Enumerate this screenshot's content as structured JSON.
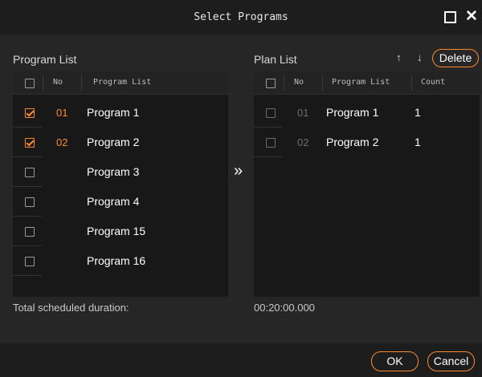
{
  "window": {
    "title": "Select Programs"
  },
  "program_list": {
    "label": "Program List",
    "headers": {
      "no": "No",
      "name": "Program  List"
    },
    "rows": [
      {
        "no": "01",
        "name": "Program 1",
        "checked": true
      },
      {
        "no": "02",
        "name": "Program 2",
        "checked": true
      },
      {
        "no": "",
        "name": "Program 3",
        "checked": false
      },
      {
        "no": "",
        "name": "Program 4",
        "checked": false
      },
      {
        "no": "",
        "name": "Program 15",
        "checked": false
      },
      {
        "no": "",
        "name": "Program 16",
        "checked": false
      }
    ]
  },
  "plan_list": {
    "label": "Plan List",
    "up_icon": "↑",
    "down_icon": "↓",
    "delete_label": "Delete",
    "headers": {
      "no": "No",
      "name": "Program  List",
      "count": "Count"
    },
    "rows": [
      {
        "no": "01",
        "name": "Program 1",
        "count": "1"
      },
      {
        "no": "02",
        "name": "Program 2",
        "count": "1"
      }
    ]
  },
  "move_icon": "»",
  "total": {
    "label": "Total scheduled duration:",
    "value": "00:20:00.000"
  },
  "footer": {
    "ok_label": "OK",
    "cancel_label": "Cancel"
  },
  "colors": {
    "accent": "#ff8a2b",
    "background": "#262626",
    "panel": "#181818"
  }
}
